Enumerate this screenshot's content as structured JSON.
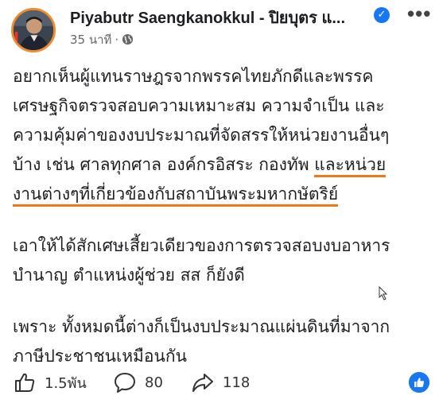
{
  "header": {
    "author": "Piyabutr Saengkanokkul - ปิยบุตร แ...",
    "time": "35 นาที",
    "dot": "·",
    "more_glyph": "•••",
    "verified_glyph": "✓"
  },
  "content": {
    "paragraphs": [
      {
        "lines": [
          "อยากเห็นผู้แทนราษฎรจากพรรคไทยภักดีและพรรค",
          "เศรษฐกิจตรวจสอบความเหมาะสม ความจำเป็น และ",
          "ความคุ้มค่าของงบประมาณที่จัดสรรให้หน่วยงานอื่นๆ"
        ],
        "line4_before": "บ้าง เช่น ศาลทุกศาล องค์กรอิสระ กองทัพ ",
        "line4_highlight": "และหน่วย",
        "line5_highlight": "งานต่างๆที่เกี่ยวข้องกับสถาบันพระมหากษัตริย์"
      },
      {
        "lines": [
          "เอาให้ได้สักเศษเสี้ยวเดียวของการตรวจสอบงบอาหาร",
          "บำนาญ ตำแหน่งผู้ช่วย สส ก็ยังดี"
        ]
      },
      {
        "lines": [
          "เพราะ ทั้งหมดนี้ต่างก็เป็นงบประมาณแผ่นดินที่มาจาก",
          "ภาษีประชาชนเหมือนกัน"
        ]
      }
    ]
  },
  "footer": {
    "likes": "1.5พัน",
    "comments": "80",
    "shares": "118"
  },
  "colors": {
    "highlight_underline": "#f07a1a",
    "avatar_ring": "#f08a2a",
    "brand_blue": "#1877f2"
  },
  "icons": [
    "globe-icon",
    "like-icon",
    "comment-icon",
    "share-icon",
    "like-reaction-icon",
    "verified-icon",
    "more-icon"
  ]
}
